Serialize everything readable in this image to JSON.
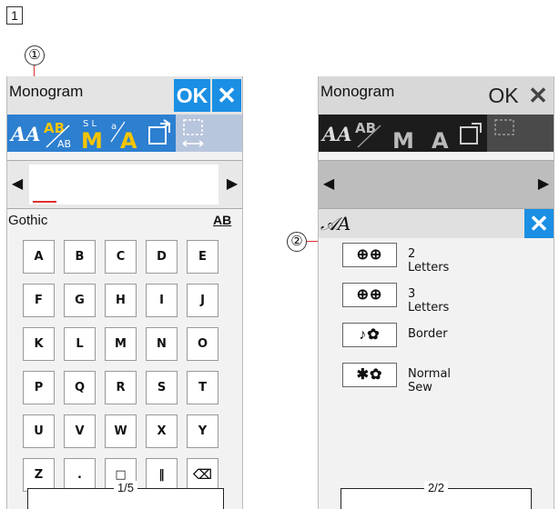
{
  "step_number": "1",
  "callouts": {
    "one": "①",
    "two": "②"
  },
  "left_screen": {
    "title": "Monogram",
    "ok_label": "OK",
    "close_icon": "close-icon",
    "tools": [
      "font-select-icon",
      "letter-size-icon",
      "monogram-m-icon",
      "letter-case-icon",
      "file-open-icon",
      "layout-icon"
    ],
    "arrow_left": "◀",
    "arrow_right": "▶",
    "font_name": "Gothic",
    "case_label": "AB",
    "keys": [
      "A",
      "B",
      "C",
      "D",
      "E",
      "F",
      "G",
      "H",
      "I",
      "J",
      "K",
      "L",
      "M",
      "N",
      "O",
      "P",
      "Q",
      "R",
      "S",
      "T",
      "U",
      "V",
      "W",
      "X",
      "Y",
      "Z",
      ".",
      "□",
      "‖",
      "⌫"
    ],
    "page_indicator": "1/5"
  },
  "right_screen": {
    "title": "Monogram",
    "ok_label": "OK",
    "arrow_left": "◀",
    "arrow_right": "▶",
    "panel_title": "𝒜A",
    "options": [
      {
        "label": "2 Letters",
        "icon": "two-letters-icon"
      },
      {
        "label": "3 Letters",
        "icon": "three-letters-icon"
      },
      {
        "label": "Border",
        "icon": "border-icon"
      },
      {
        "label": "Normal Sew",
        "icon": "normal-sew-icon"
      }
    ],
    "page_indicator": "2/2"
  },
  "colors": {
    "accent_blue": "#1a8fe3",
    "toolbar_blue": "#2d7fd0",
    "yellow": "#f5c400",
    "cursor_red": "#e03030",
    "dark_toolbar": "#222222"
  }
}
